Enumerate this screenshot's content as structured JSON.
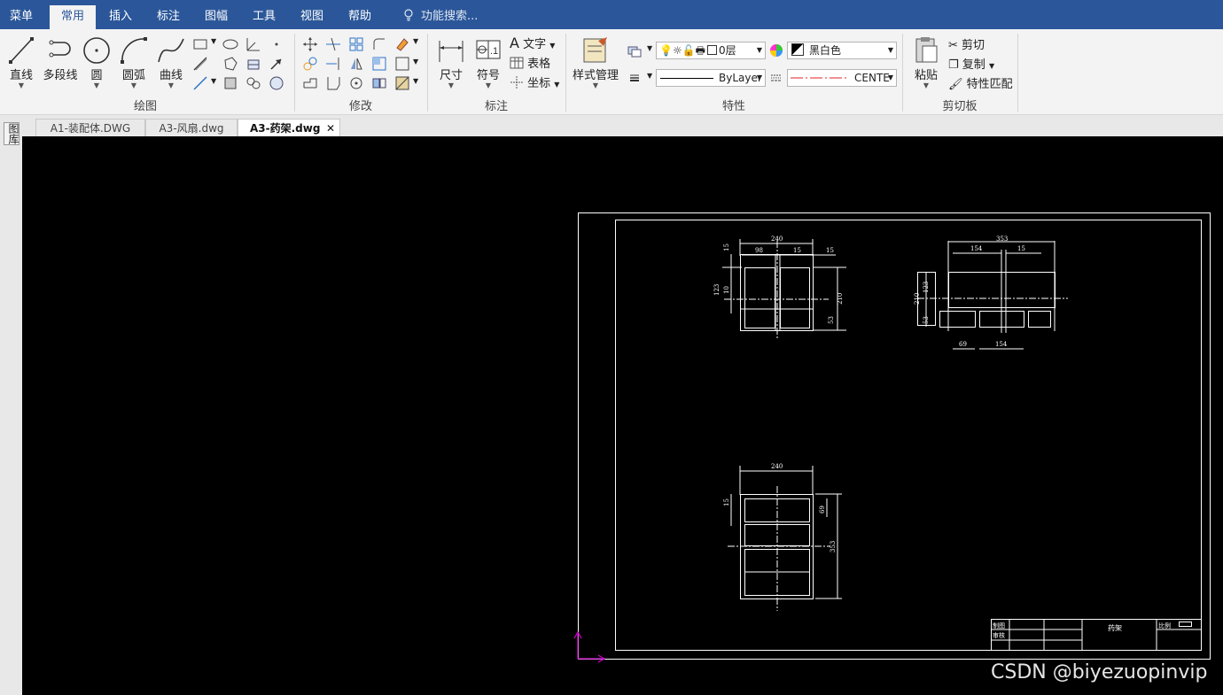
{
  "menubar": {
    "tabs": [
      "菜单",
      "常用",
      "插入",
      "标注",
      "图幅",
      "工具",
      "视图",
      "帮助"
    ],
    "active": "常用",
    "search_placeholder": "功能搜索..."
  },
  "ribbon": {
    "draw": {
      "label": "绘图",
      "tools": [
        "直线",
        "多段线",
        "圆",
        "圆弧",
        "曲线"
      ]
    },
    "modify": {
      "label": "修改"
    },
    "annotate": {
      "label": "标注",
      "tools": [
        "尺寸",
        "符号"
      ],
      "text": "文字",
      "table": "表格",
      "coord": "坐标"
    },
    "properties": {
      "label": "特性",
      "style_manager": "样式管理",
      "layer": "0层",
      "color": "黑白色",
      "linetype": "ByLayer",
      "line_style": "CENTE"
    },
    "clipboard": {
      "label": "剪切板",
      "paste": "粘贴",
      "cut": "剪切",
      "copy": "复制",
      "match": "特性匹配"
    }
  },
  "doc_tabs": [
    "A1-装配体.DWG",
    "A3-风扇.dwg",
    "A3-药架.dwg"
  ],
  "side_label": "图库",
  "drawing": {
    "title": "药架",
    "title_block": {
      "drawn": "制图",
      "checked": "审核",
      "scale": "比例"
    },
    "view1_dims": [
      "240",
      "98",
      "15",
      "15",
      "15",
      "123",
      "10",
      "210",
      "53"
    ],
    "view2_dims": [
      "353",
      "154",
      "15",
      "210",
      "123",
      "53",
      "69",
      "154"
    ],
    "view3_dims": [
      "240",
      "15",
      "69",
      "353"
    ]
  },
  "watermark": "CSDN @biyezuopinvip",
  "colors": {
    "menubar": "#2b579a",
    "canvas": "#000000",
    "ucs": "#d000d0",
    "line_red": "#e02020"
  }
}
